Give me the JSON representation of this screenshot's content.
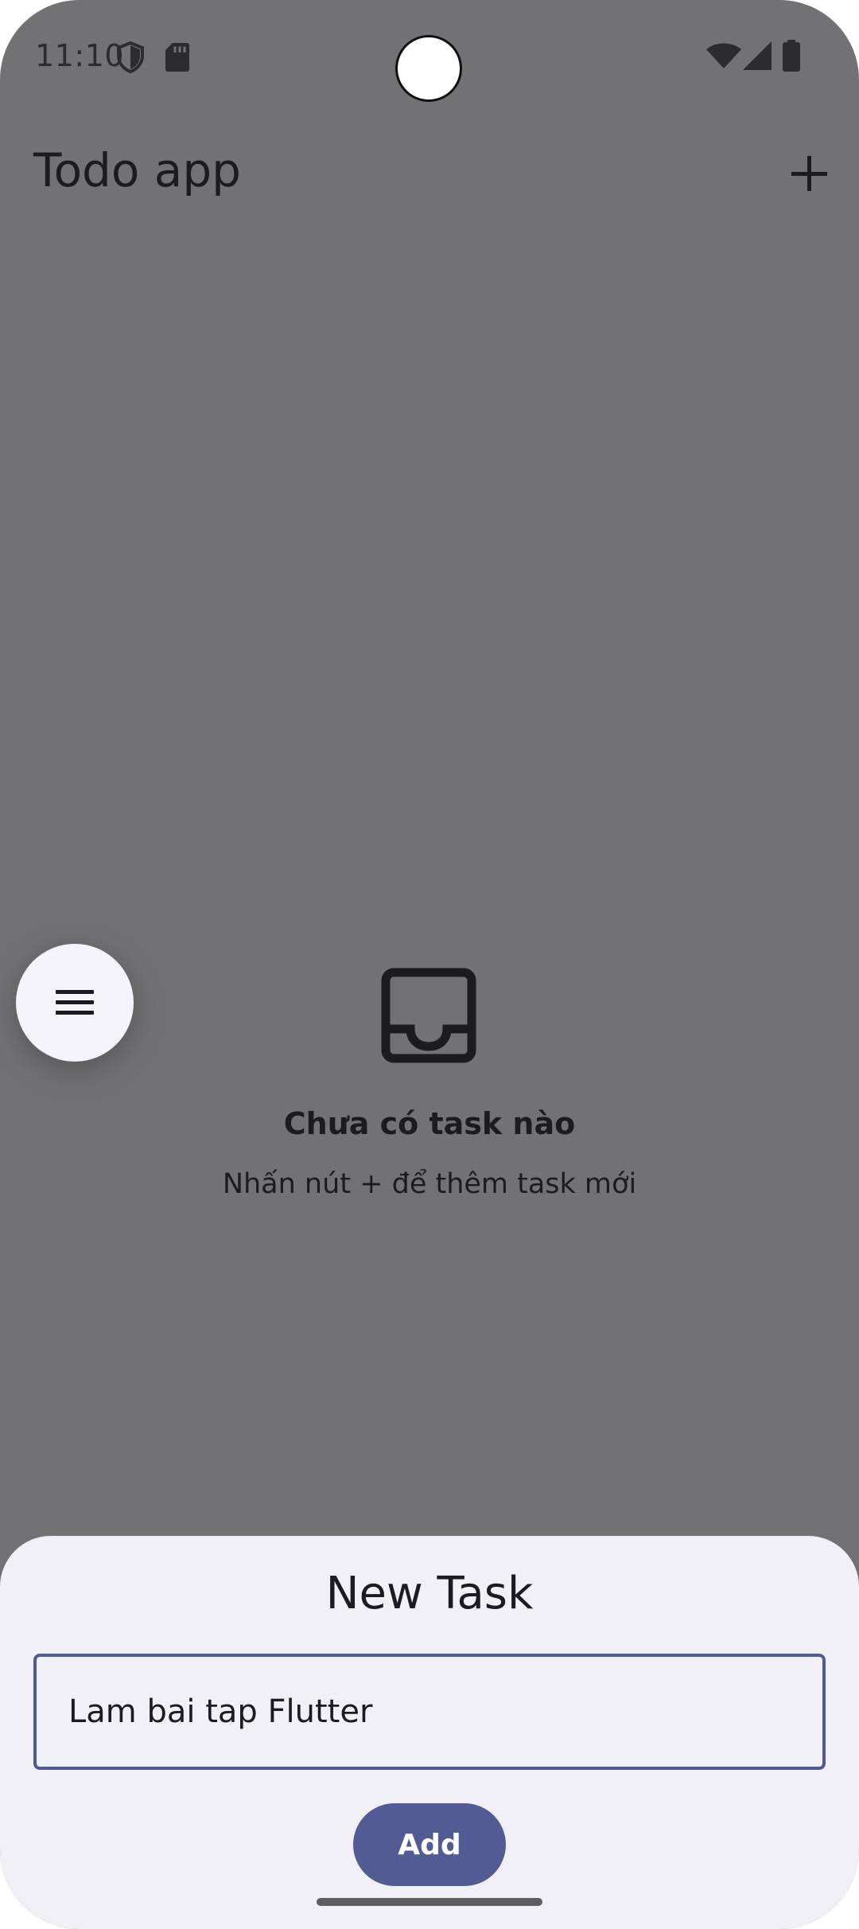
{
  "status_bar": {
    "time": "11:10",
    "icons": [
      "shield-icon",
      "sd-card-icon",
      "wifi-icon",
      "signal-icon",
      "battery-icon"
    ]
  },
  "app_bar": {
    "title": "Todo app",
    "action_icon": "plus-icon"
  },
  "empty_state": {
    "icon": "inbox-icon",
    "title": "Chưa có task nào",
    "subtitle": "Nhấn nút + để thêm task mới"
  },
  "fab": {
    "icon": "menu-icon"
  },
  "bottom_sheet": {
    "title": "New Task",
    "input_value": "Lam bai tap Flutter",
    "add_label": "Add"
  },
  "colors": {
    "scrim": "#727274",
    "sheet": "#f2f0f7",
    "accent": "#535b94",
    "text": "#1c1b1f"
  }
}
